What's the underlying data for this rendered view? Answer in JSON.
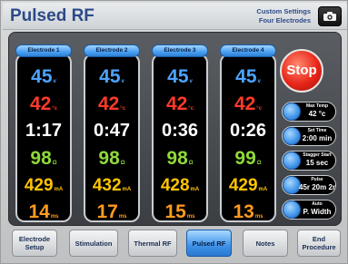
{
  "header": {
    "title": "Pulsed RF",
    "subtitle_line1": "Custom Settings",
    "subtitle_line2": "Four Electrodes",
    "camera_icon": "camera-icon"
  },
  "electrodes": [
    {
      "label": "Electrode 1",
      "voltage": "45",
      "voltage_unit": "v",
      "temp": "42",
      "temp_unit": "°c",
      "time": "1:17",
      "impedance": "98",
      "impedance_unit": "Ω",
      "current": "429",
      "current_unit": "mA",
      "pulse_width": "14",
      "pulse_unit": "ms"
    },
    {
      "label": "Electrode 2",
      "voltage": "45",
      "voltage_unit": "v",
      "temp": "42",
      "temp_unit": "°c",
      "time": "0:47",
      "impedance": "98",
      "impedance_unit": "Ω",
      "current": "432",
      "current_unit": "mA",
      "pulse_width": "17",
      "pulse_unit": "ms"
    },
    {
      "label": "Electrode 3",
      "voltage": "45",
      "voltage_unit": "v",
      "temp": "42",
      "temp_unit": "°c",
      "time": "0:36",
      "impedance": "98",
      "impedance_unit": "Ω",
      "current": "428",
      "current_unit": "mA",
      "pulse_width": "15",
      "pulse_unit": "ms"
    },
    {
      "label": "Electrode 4",
      "voltage": "45",
      "voltage_unit": "v",
      "temp": "42",
      "temp_unit": "°c",
      "time": "0:26",
      "impedance": "99",
      "impedance_unit": "Ω",
      "current": "429",
      "current_unit": "mA",
      "pulse_width": "13",
      "pulse_unit": "ms"
    }
  ],
  "controls": {
    "stop_label": "Stop",
    "params": [
      {
        "label": "Max Temp",
        "value": "42 °c"
      },
      {
        "label": "Set Time",
        "value": "2:00 min"
      },
      {
        "label": "Stagger Start",
        "value": "15 sec"
      },
      {
        "label": "Pulse",
        "value": "45r 20m 2r"
      },
      {
        "label": "Auto",
        "value": "P. Width"
      }
    ]
  },
  "nav": {
    "items": [
      {
        "label": "Electrode Setup",
        "active": false
      },
      {
        "label": "Stimulation",
        "active": false
      },
      {
        "label": "Thermal RF",
        "active": false
      },
      {
        "label": "Pulsed RF",
        "active": true
      },
      {
        "label": "Notes",
        "active": false
      },
      {
        "label": "End Procedure",
        "active": false
      }
    ]
  },
  "colors": {
    "title": "#2d4a88",
    "voltage": "#4da3ff",
    "temperature": "#ff3a2a",
    "time": "#ffffff",
    "impedance": "#8fd93a",
    "current": "#ffc400",
    "pulse_width": "#ff9a1f",
    "stop": "#e8261a",
    "accent": "#3f93e8"
  }
}
